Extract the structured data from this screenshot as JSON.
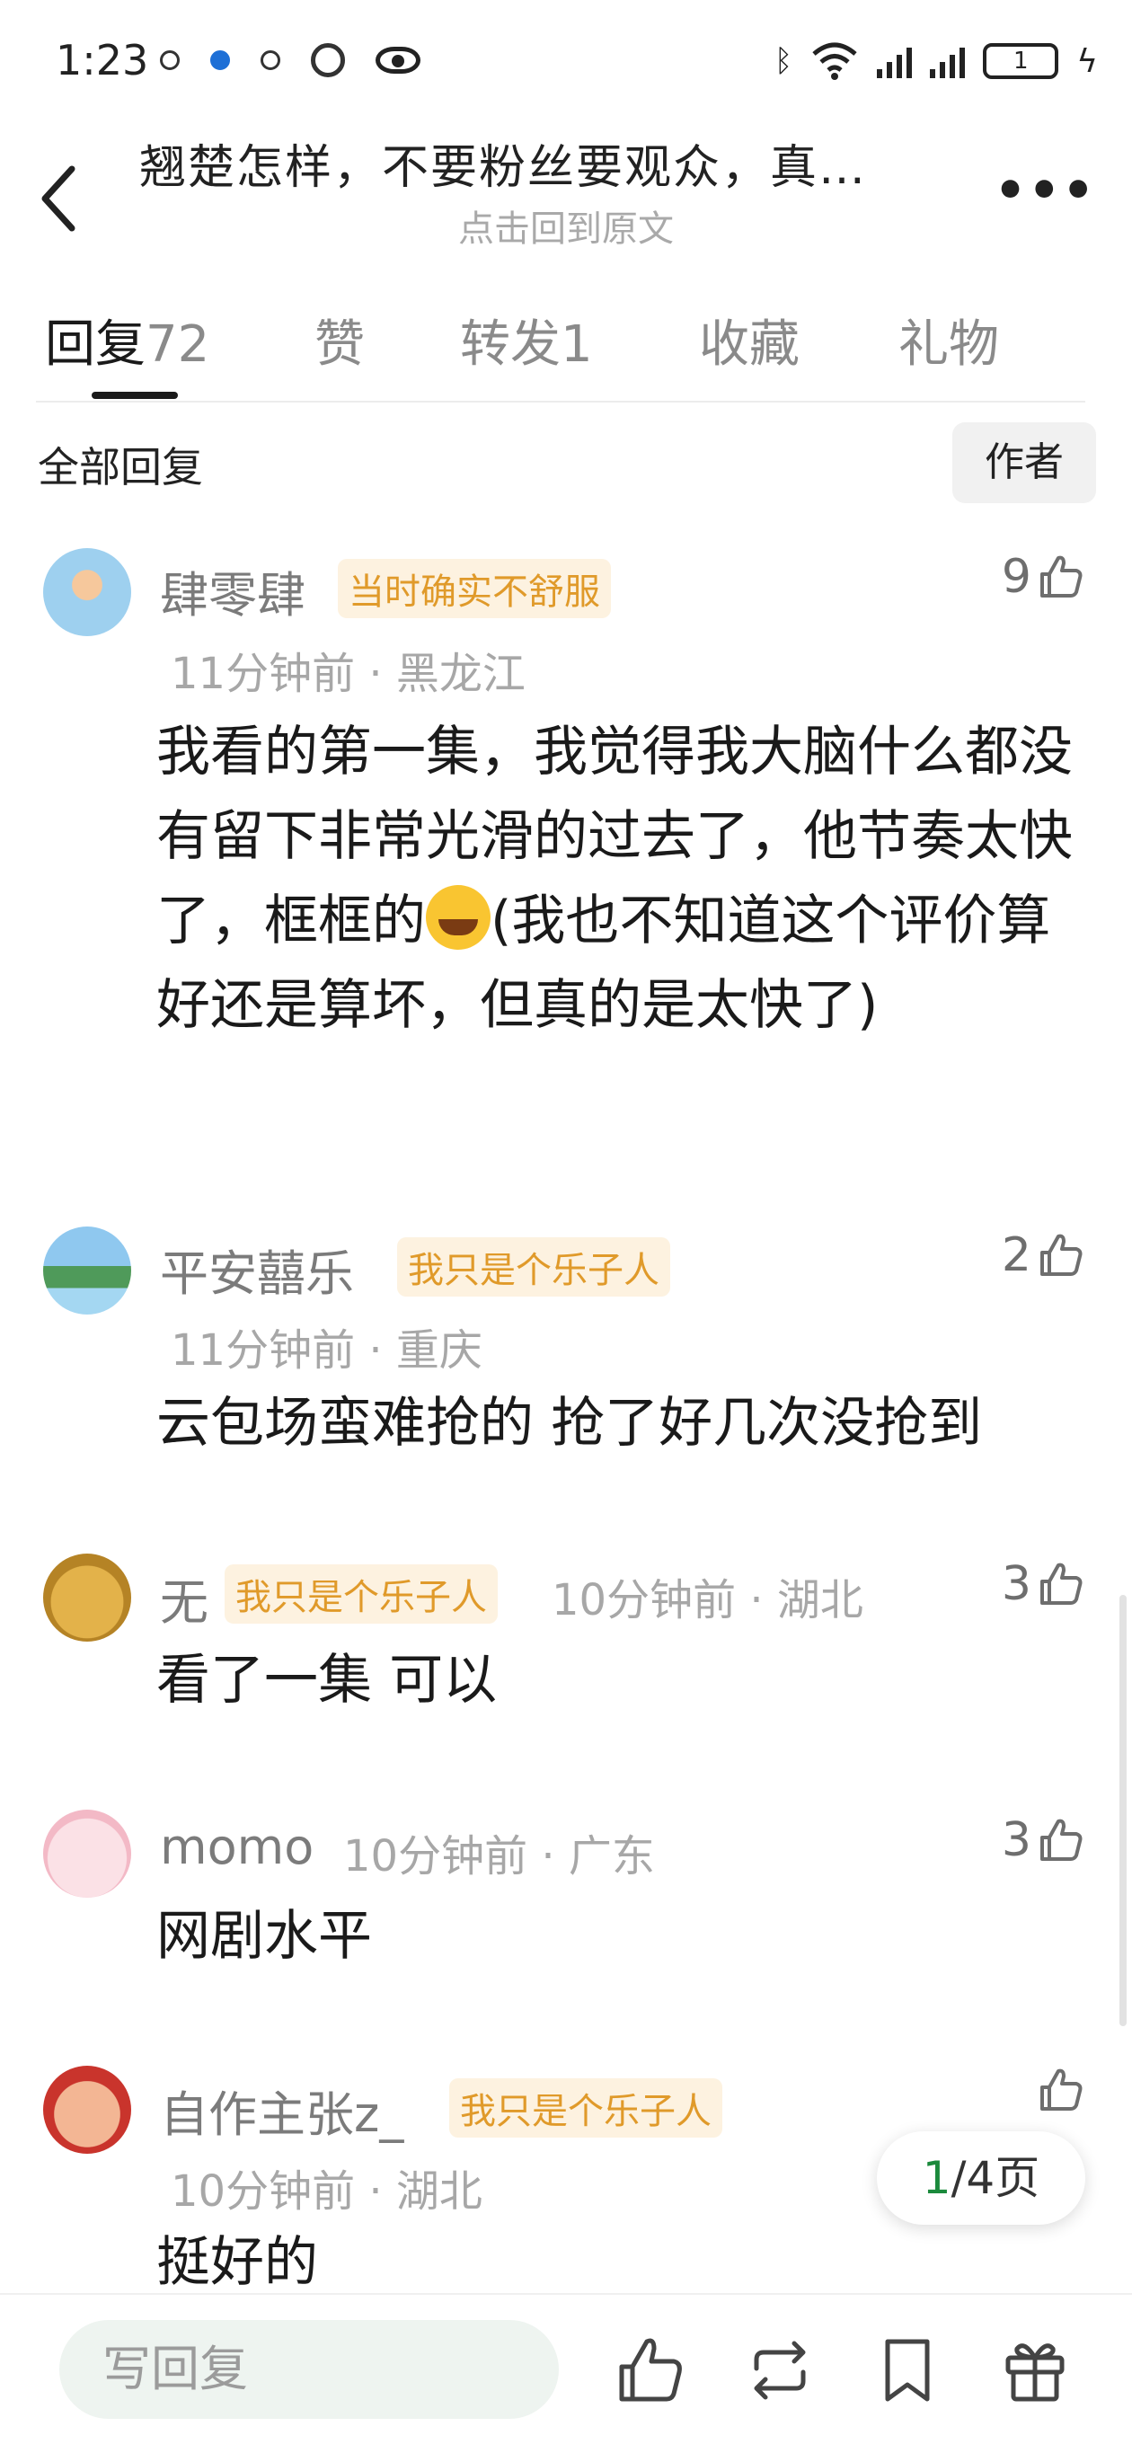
{
  "status_bar": {
    "time": "1:23",
    "battery": "1"
  },
  "header": {
    "title": "翘楚怎样，不要粉丝要观众，真…",
    "subtitle": "点击回到原文"
  },
  "tabs": [
    {
      "label": "回复",
      "count": "72"
    },
    {
      "label": "赞",
      "count": ""
    },
    {
      "label": "转发",
      "count": "1"
    },
    {
      "label": "收藏",
      "count": ""
    },
    {
      "label": "礼物",
      "count": ""
    }
  ],
  "filter": {
    "label": "全部回复",
    "author_button": "作者"
  },
  "comments": [
    {
      "nickname": "肆零肆",
      "badge": "当时确实不舒服",
      "time": "11分钟前",
      "location": "黑龙江",
      "likes": "9",
      "text_before_emoji": "我看的第一集，我觉得我大脑什么都没有留下非常光滑的过去了，他节奏太快了，框框的",
      "text_after_emoji": "(我也不知道这个评价算好还是算坏，但真的是太快了)"
    },
    {
      "nickname": "平安囍乐",
      "badge": "我只是个乐子人",
      "time": "11分钟前",
      "location": "重庆",
      "likes": "2",
      "text": "云包场蛮难抢的 抢了好几次没抢到"
    },
    {
      "nickname": "无",
      "badge": "我只是个乐子人",
      "time": "10分钟前",
      "location": "湖北",
      "likes": "3",
      "text": "看了一集 可以"
    },
    {
      "nickname": "momo",
      "badge": "",
      "time": "10分钟前",
      "location": "广东",
      "likes": "3",
      "text": "网剧水平"
    },
    {
      "nickname": "自作主张z_",
      "badge": "我只是个乐子人",
      "time": "10分钟前",
      "location": "湖北",
      "likes": "",
      "text": "挺好的"
    }
  ],
  "meta_separator": "·",
  "pagination": {
    "current": "1",
    "total_suffix": "/4页"
  },
  "bottom_bar": {
    "reply_placeholder": "写回复"
  },
  "colors": {
    "badge_text": "#e09a2a",
    "badge_bg": "#fdf2e0",
    "page_current": "#1b8a3c"
  }
}
